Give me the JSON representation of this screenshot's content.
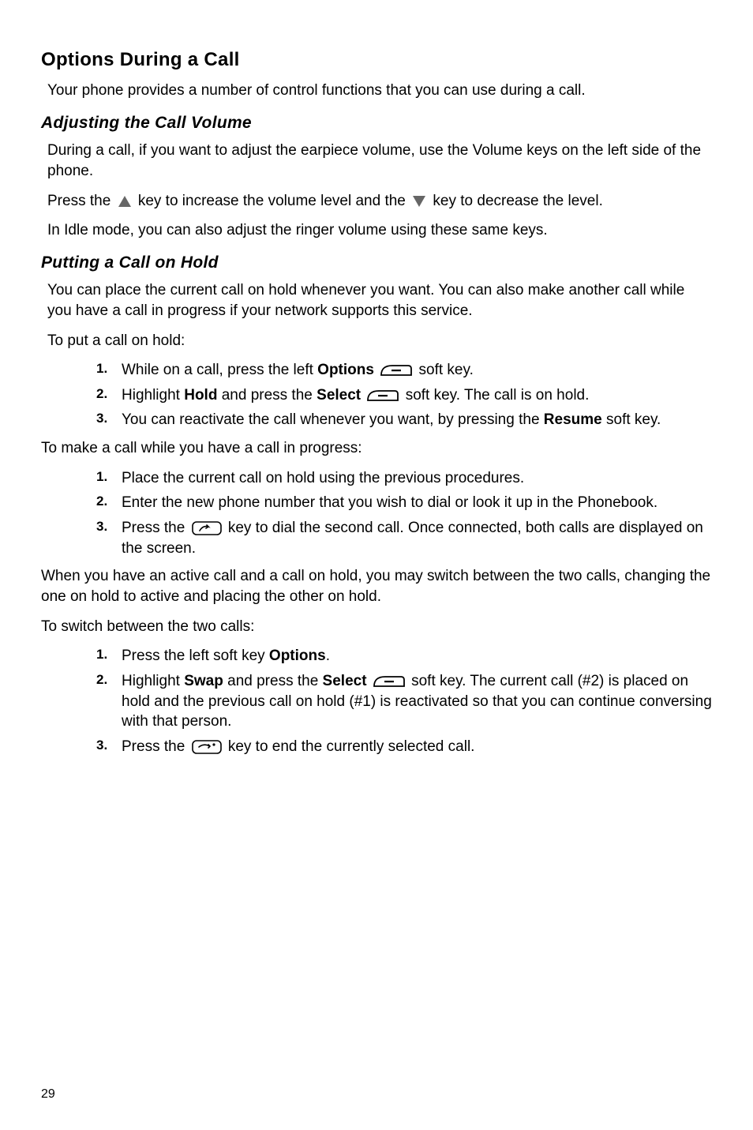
{
  "section": {
    "heading": "Options During a Call",
    "intro": "Your phone provides a number of control functions that you can use during a call."
  },
  "volume": {
    "heading": "Adjusting the Call Volume",
    "p1": "During a call, if you want to adjust the earpiece volume, use the Volume keys on the left side of the phone.",
    "p2_a": "Press the ",
    "p2_b": " key to increase the volume level and the ",
    "p2_c": " key to decrease the level.",
    "p3": "In Idle mode, you can also adjust the ringer volume using these same keys."
  },
  "hold": {
    "heading": "Putting a Call on Hold",
    "p1": "You can place the current call on hold whenever you want. You can also make another call while you have a call in progress if your network supports this service.",
    "p2": "To put a call on hold:",
    "list1": {
      "n1": "1.",
      "t1a": "While on a call, press the left ",
      "t1b": "Options",
      "t1c": " soft key.",
      "n2": "2.",
      "t2a": "Highlight ",
      "t2b": "Hold",
      "t2c": " and press the ",
      "t2d": "Select",
      "t2e": " soft key. The call is on hold.",
      "n3": "3.",
      "t3a": "You can reactivate the call whenever you want, by pressing the ",
      "t3b": "Resume",
      "t3c": " soft key."
    },
    "p3": "To make a call while you have a call in progress:",
    "list2": {
      "n1": "1.",
      "t1": "Place the current call on hold using the previous procedures.",
      "n2": "2.",
      "t2": "Enter the new phone number that you wish to dial or look it up in the Phonebook.",
      "n3": "3.",
      "t3a": "Press the ",
      "t3b": " key to dial the second call. Once connected, both calls are displayed on the screen."
    },
    "p4": "When you have an active call and a call on hold, you may switch between the two calls, changing the one on hold to active and placing the other on hold.",
    "p5": "To switch between the two calls:",
    "list3": {
      "n1": "1.",
      "t1a": "Press the left soft key ",
      "t1b": "Options",
      "t1c": ".",
      "n2": "2.",
      "t2a": "Highlight ",
      "t2b": "Swap",
      "t2c": " and press the ",
      "t2d": "Select",
      "t2e": " soft key. The current call (#2) is placed on hold and the previous call on hold (#1) is reactivated so that you can continue conversing with that person.",
      "n3": "3.",
      "t3a": "Press the ",
      "t3b": " key to end the currently selected call."
    }
  },
  "pagenum": "29"
}
